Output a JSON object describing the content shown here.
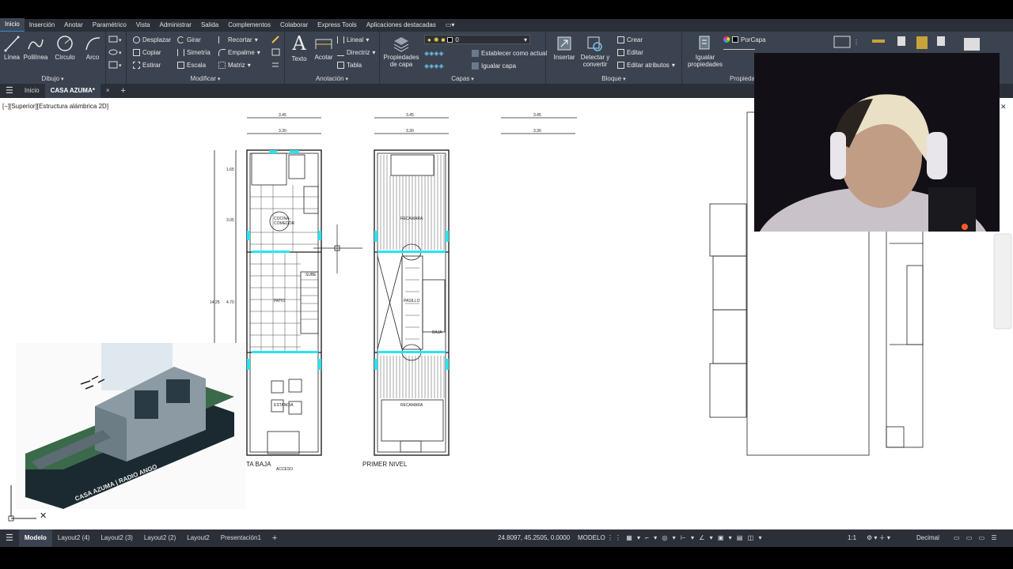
{
  "menu": {
    "items": [
      "Inicio",
      "Inserción",
      "Anotar",
      "Paramétrico",
      "Vista",
      "Administrar",
      "Salida",
      "Complementos",
      "Colaborar",
      "Express Tools",
      "Aplicaciones destacadas"
    ]
  },
  "ribbon": {
    "dibujo": {
      "title": "Dibujo",
      "linea": "Línea",
      "polilinea": "Polilínea",
      "circulo": "Círculo",
      "arco": "Arco"
    },
    "modificar": {
      "title": "Modificar",
      "desplazar": "Desplazar",
      "girar": "Girar",
      "recortar": "Recortar",
      "copiar": "Copiar",
      "simetria": "Simetría",
      "empalme": "Empalme",
      "estirar": "Estirar",
      "escala": "Escala",
      "matriz": "Matriz"
    },
    "anotacion": {
      "title": "Anotación",
      "texto": "Texto",
      "acotar": "Acotar",
      "lineal": "Lineal",
      "directriz": "Directriz",
      "tabla": "Tabla"
    },
    "capas": {
      "title": "Capas",
      "propiedades_line1": "Propiedades",
      "propiedades_line2": "de capa",
      "current_layer": "0",
      "establecer": "Establecer como actual",
      "igualar": "Igualar capa"
    },
    "bloque": {
      "title": "Bloque",
      "insertar": "Insertar",
      "detectar_line1": "Detectar y",
      "detectar_line2": "convertir",
      "crear": "Crear",
      "editar": "Editar",
      "editar_atributos": "Editar atributos"
    },
    "propiedades": {
      "title": "Propieda",
      "igualar_line1": "Igualar",
      "igualar_line2": "propiedades",
      "porcapa": "PorCapa",
      "porcapa2": "PorCapa"
    }
  },
  "tabs": {
    "home": "Inicio",
    "drawing": "CASA AZUMA*"
  },
  "canvas": {
    "viewport_label": "[−][Superior][Estructura alámbrica 2D]",
    "plan": {
      "dim_345": "3.45",
      "dim_330": "3.30",
      "dim_165": "1.65",
      "dim_305": "3.05",
      "dim_1425": "14.25",
      "dim_470": "4.70",
      "cocina": "COCINA-",
      "comedor": "COMEDOR",
      "patio": "PATIO",
      "sube": "SUBE",
      "estancia": "ESTANCIA",
      "acceso": "ACCESO",
      "recamara": "RECAMARA",
      "pasillo": "PASILLO",
      "baja": "BAJA",
      "label_baja": "TA BAJA",
      "label_primer": "PRIMER NIVEL"
    },
    "render_text": "CASA AZUMA | RADIO ANGO"
  },
  "status": {
    "layouts": [
      "Modelo",
      "Layout2 (4)",
      "Layout2 (3)",
      "Layout2 (2)",
      "Layout2",
      "Presentación1"
    ],
    "coords": "24.8097, 45.2505, 0.0000",
    "mode": "MODELO",
    "scale": "1:1",
    "units": "Decimal"
  },
  "colors": {
    "accent": "#2a8fd6",
    "ribbon": "#3b4350",
    "menu": "#2b3038",
    "cyan": "#29e3f0"
  }
}
